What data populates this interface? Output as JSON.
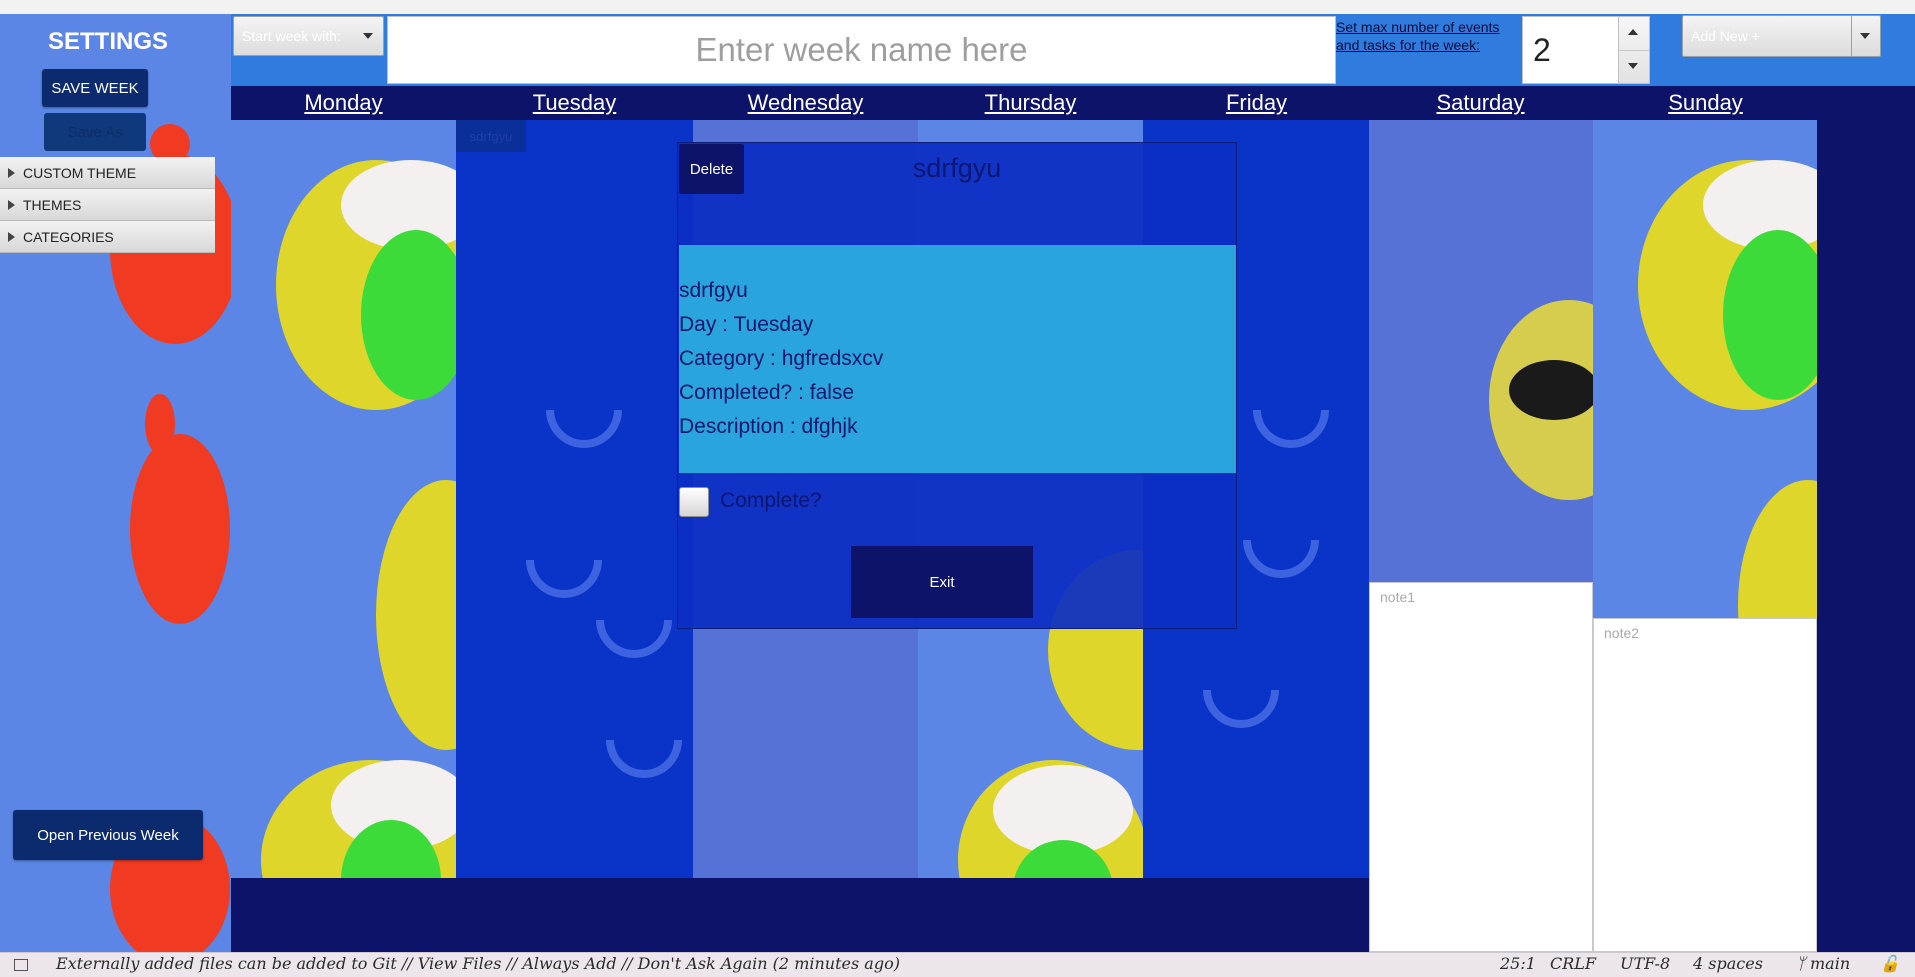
{
  "settings": {
    "title": "SETTINGS",
    "save_week": "SAVE WEEK",
    "save_as": "Save As",
    "accordion": [
      "CUSTOM THEME",
      "THEMES",
      "CATEGORIES"
    ],
    "open_previous_week": "Open Previous Week"
  },
  "toolbar": {
    "start_week_with": "Start week with:",
    "week_name_placeholder": "Enter week name here",
    "max_events_link_line1": "Set max number of events",
    "max_events_link_line2": "and tasks for the week:",
    "max_events_value": "2",
    "add_new": "Add New +"
  },
  "days": [
    "Monday",
    "Tuesday",
    "Wednesday",
    "Thursday",
    "Friday",
    "Saturday",
    "Sunday"
  ],
  "event_tile": {
    "label": "sdrfgyu"
  },
  "notes": {
    "saturday_placeholder": "note1",
    "sunday_placeholder": "note2"
  },
  "popup": {
    "delete": "Delete",
    "title": "sdrfgyu",
    "details": {
      "name": "sdrfgyu",
      "day": "Day : Tuesday",
      "category": "Category : hgfredsxcv",
      "completed": "Completed? : false",
      "description": "Description : dfghjk"
    },
    "complete_label": "Complete?",
    "complete_checked": false,
    "exit": "Exit"
  },
  "statusbar": {
    "message": "Externally added files can be added to Git // View Files // Always Add // Don't Ask Again (2 minutes ago)",
    "position": "25:1",
    "line_ending": "CRLF",
    "encoding": "UTF-8",
    "indent": "4 spaces",
    "branch": "main"
  },
  "colors": {
    "header_navy": "#0e136a",
    "toolbar_blue": "#2f7cde",
    "popup_blue": "#0c2ec4",
    "details_cyan": "#2aa4dc",
    "crab_red": "#f03a22"
  }
}
